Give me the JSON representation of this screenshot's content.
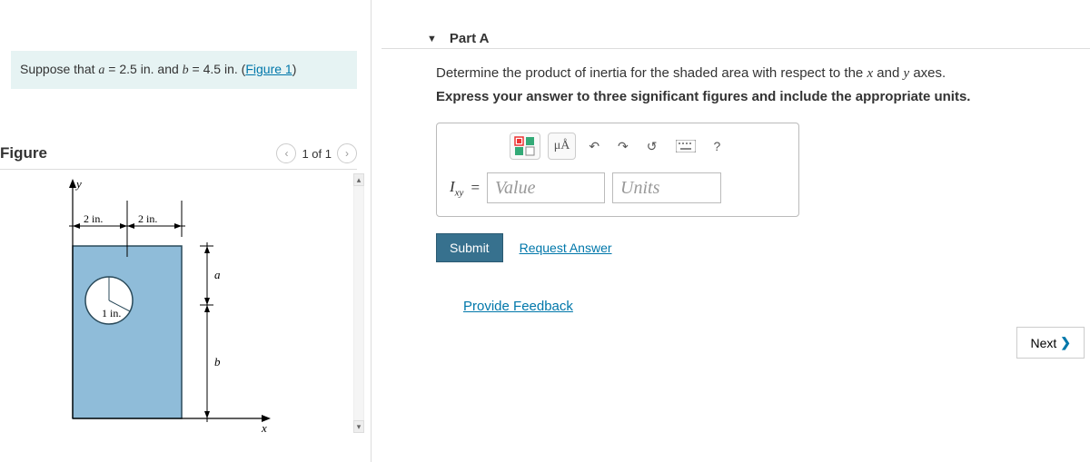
{
  "problem": {
    "text_prefix": "Suppose that ",
    "a_var": "a",
    "a_eq": " = 2.5 ",
    "unit1": "in.",
    "and": " and ",
    "b_var": "b",
    "b_eq": " = 4.5 ",
    "unit2": "in.",
    "space_paren_open": " (",
    "figure_link": "Figure 1",
    "paren_close": ")"
  },
  "figure": {
    "title": "Figure",
    "counter": "1 of 1",
    "labels": {
      "y": "y",
      "x": "x",
      "a": "a",
      "b": "b",
      "two_in_left": "2 in.",
      "two_in_right": "2 in.",
      "one_in": "1 in."
    }
  },
  "part": {
    "title": "Part A",
    "desc_prefix": "Determine the product of inertia for the shaded area with respect to the ",
    "x_var": "x",
    "and": " and ",
    "y_var": "y",
    "desc_suffix": " axes.",
    "instruction": "Express your answer to three significant figures and include the appropriate units.",
    "answer": {
      "symbol_html": "I",
      "symbol_sub": "xy",
      "equals": " = ",
      "value_placeholder": "Value",
      "units_placeholder": "Units"
    },
    "toolbar": {
      "mu_a": "μÅ",
      "help": "?"
    },
    "submit": "Submit",
    "request": "Request Answer"
  },
  "feedback": "Provide Feedback",
  "next": "Next"
}
